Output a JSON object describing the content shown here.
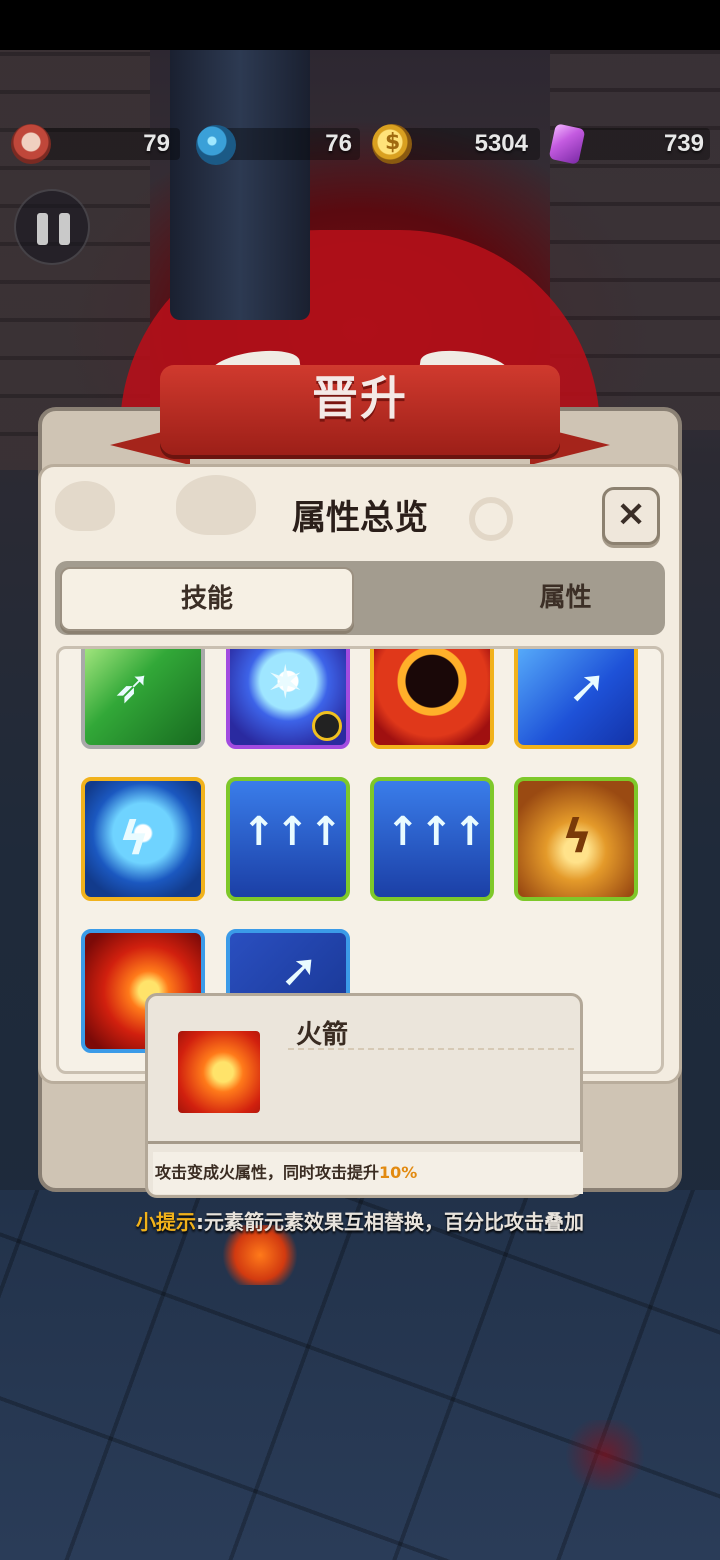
{
  "hud": {
    "medals": "79",
    "orbs": "76",
    "coins": "5304",
    "gems": "739"
  },
  "banner": {
    "title": "晋升"
  },
  "dialog": {
    "title": "属性总览",
    "close_label": "×",
    "tabs": [
      {
        "label": "技能",
        "active": true
      },
      {
        "label": "属性",
        "active": false
      }
    ]
  },
  "skills": [
    {
      "icon": "green-arrow-icon",
      "frame": "gray"
    },
    {
      "icon": "ice-star-icon",
      "frame": "purple",
      "badge": "shield-icon"
    },
    {
      "icon": "bomb-icon",
      "frame": "gold"
    },
    {
      "icon": "ghost-arrow-icon",
      "frame": "gold"
    },
    {
      "icon": "lightning-ghost-icon",
      "frame": "gold"
    },
    {
      "icon": "triple-arrow-icon",
      "frame": "green"
    },
    {
      "icon": "triple-arrow-icon",
      "frame": "green"
    },
    {
      "icon": "lightning-box-icon",
      "frame": "green"
    },
    {
      "icon": "fire-arrow-icon",
      "frame": "blue"
    },
    {
      "icon": "ghost-arrow-icon",
      "frame": "blue"
    }
  ],
  "tooltip": {
    "name": "火箭",
    "icon": "fire-arrow-icon",
    "desc_prefix": "攻击变成火属性，同时攻击提升",
    "desc_value": "10%"
  },
  "tip": {
    "label": "小提示",
    "text": ":元素箭元素效果互相替换，百分比攻击叠加"
  },
  "colors": {
    "accent_orange": "#e28a10",
    "tip_yellow": "#f2b21a",
    "ribbon_red": "#c0322a"
  }
}
